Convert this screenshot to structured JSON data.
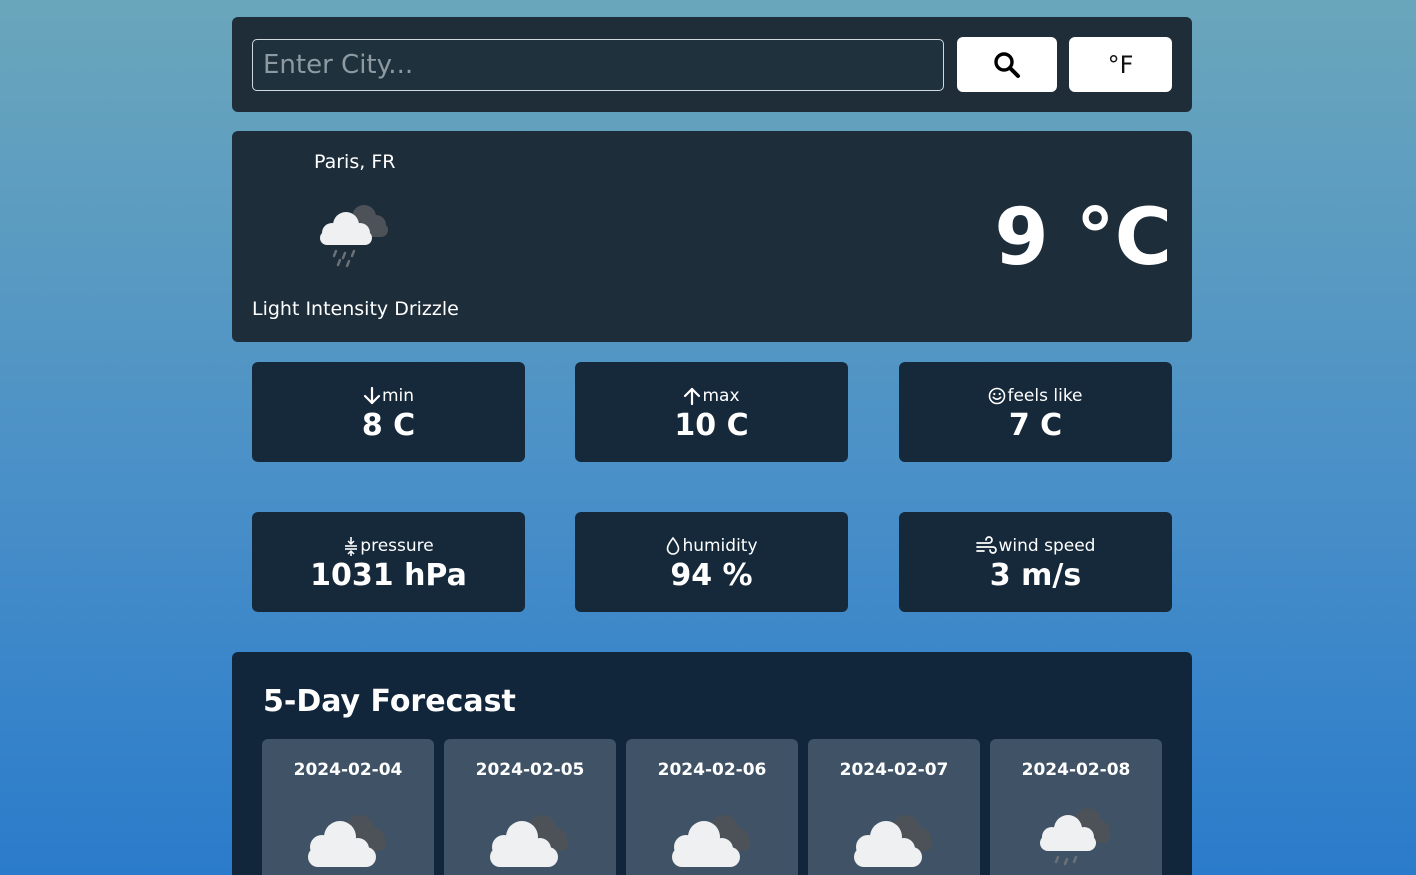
{
  "search": {
    "placeholder": "Enter City...",
    "value": "",
    "search_icon": "search-icon",
    "unit_toggle_label": "°F"
  },
  "current": {
    "location": "Paris, FR",
    "icon": "drizzle-cloud-icon",
    "description": "Light Intensity Drizzle",
    "temperature": "9 °C"
  },
  "stats": [
    {
      "icon": "arrow-down-icon",
      "label": "min",
      "value": "8 C"
    },
    {
      "icon": "arrow-up-icon",
      "label": "max",
      "value": "10 C"
    },
    {
      "icon": "smiley-icon",
      "label": "feels like",
      "value": "7 C"
    },
    {
      "icon": "compress-icon",
      "label": "pressure",
      "value": "1031 hPa"
    },
    {
      "icon": "droplet-icon",
      "label": "humidity",
      "value": "94 %"
    },
    {
      "icon": "wind-icon",
      "label": "wind speed",
      "value": "3 m/s"
    }
  ],
  "forecast": {
    "title": "5-Day Forecast",
    "days": [
      {
        "date": "2024-02-04",
        "icon": "cloudy-icon"
      },
      {
        "date": "2024-02-05",
        "icon": "cloudy-icon"
      },
      {
        "date": "2024-02-06",
        "icon": "cloudy-icon"
      },
      {
        "date": "2024-02-07",
        "icon": "cloudy-icon"
      },
      {
        "date": "2024-02-08",
        "icon": "drizzle-cloud-icon"
      }
    ]
  },
  "colors": {
    "panel": "#1e2d38",
    "card": "#16293b",
    "forecast_panel": "#11263b",
    "day_card": "#405366",
    "text": "#ffffff"
  }
}
